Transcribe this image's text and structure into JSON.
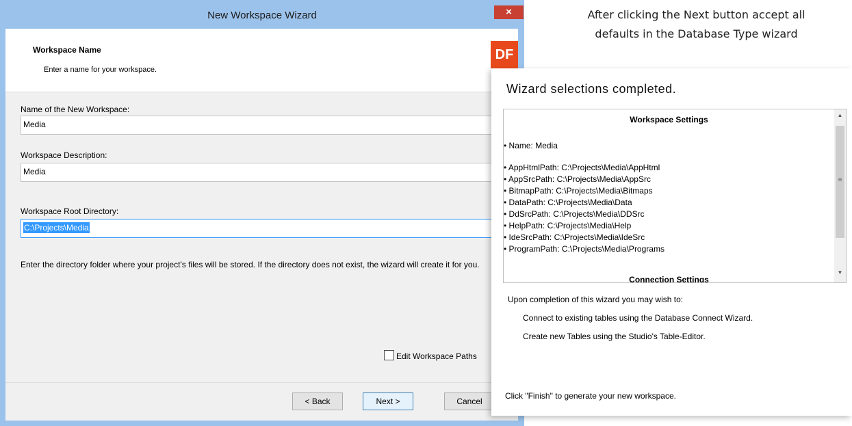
{
  "wizard": {
    "title": "New Workspace Wizard",
    "close_glyph": "×",
    "header_title": "Workspace Name",
    "header_subtitle": "Enter a name for your workspace.",
    "logo_text": "DF",
    "name_label": "Name of the New Workspace:",
    "name_value": "Media",
    "description_label": "Workspace Description:",
    "description_value": "Media",
    "root_label": "Workspace Root Directory:",
    "root_value": "C:\\Projects\\Media",
    "help_text": "Enter the directory folder where your project's files will be stored. If the directory does not exist, the wizard will create it for you.",
    "edit_paths_label": "Edit Workspace Paths",
    "edit_paths_checked": false,
    "back_label": "< Back",
    "next_label": "Next >",
    "cancel_label": "Cancel"
  },
  "caption": {
    "line1": "After clicking the Next button accept all",
    "line2": "defaults in the Database Type wizard"
  },
  "summary": {
    "title": "Wizard selections completed.",
    "workspace_settings_heading": "Workspace Settings",
    "name_line": "• Name:  Media",
    "paths": [
      "• AppHtmlPath:  C:\\Projects\\Media\\AppHtml",
      "• AppSrcPath:  C:\\Projects\\Media\\AppSrc",
      "• BitmapPath:  C:\\Projects\\Media\\Bitmaps",
      "• DataPath:  C:\\Projects\\Media\\Data",
      "• DdSrcPath:  C:\\Projects\\Media\\DDSrc",
      "• HelpPath:  C:\\Projects\\Media\\Help",
      "• IdeSrcPath:  C:\\Projects\\Media\\IdeSrc",
      "• ProgramPath:  C:\\Projects\\Media\\Programs"
    ],
    "connection_settings_heading": "Connection Settings",
    "completion_text": "Upon completion of this wizard you may wish to:",
    "option1": "Connect to existing tables using the Database Connect Wizard.",
    "option2": "Create new Tables using the Studio's Table-Editor.",
    "finish_text": "Click \"Finish\" to generate your new workspace.",
    "scroll_up_glyph": "▲",
    "scroll_down_glyph": "▼",
    "thumb_grip_glyph": "≡"
  }
}
